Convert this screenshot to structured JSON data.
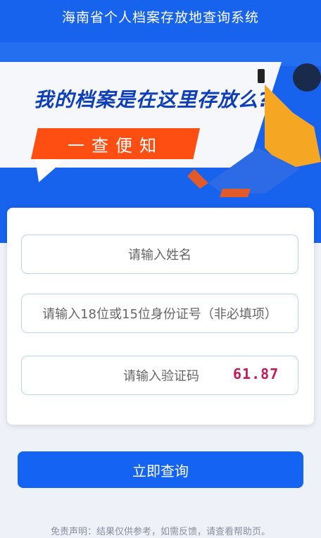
{
  "app": {
    "title": "海南省个人档案存放地查询系统"
  },
  "banner": {
    "headline": "我的档案是在这里存放么?",
    "tagline": "一查便知"
  },
  "form": {
    "name_placeholder": "请输入姓名",
    "id_placeholder": "请输入18位或15位身份证号（非必填项）",
    "captcha_placeholder": "请输入验证码",
    "captcha_code": "61.87"
  },
  "actions": {
    "query_label": "立即查询"
  },
  "footer": {
    "disclaimer": "免责声明：结果仅供参考，如需反馈，请查看帮助页。"
  },
  "colors": {
    "primary": "#1763ee",
    "accent_orange": "#ff4e12",
    "headline": "#0f3fb8"
  }
}
